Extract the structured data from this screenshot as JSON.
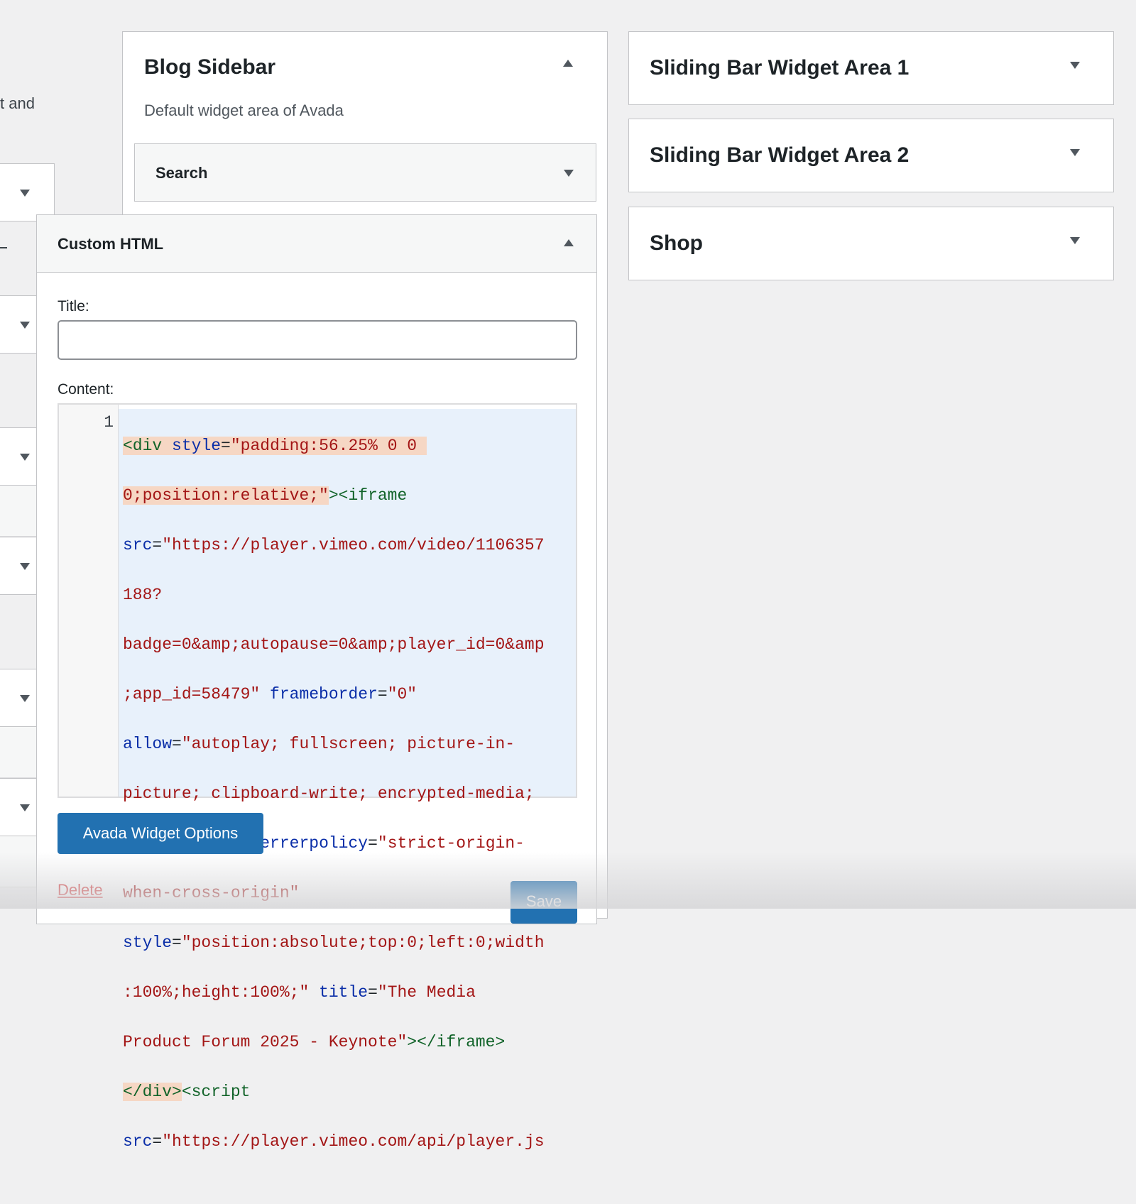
{
  "left_column": {
    "partial_text": "t and"
  },
  "blog_sidebar": {
    "title": "Blog Sidebar",
    "description": "Default widget area of Avada",
    "search_widget": "Search",
    "custom_html": {
      "title": "Custom HTML",
      "title_label": "Title:",
      "title_value": "",
      "content_label": "Content:",
      "line_number": "1",
      "code_lines": [
        "<div style=\"padding:56.25% 0 0 ",
        "0;position:relative;\"><iframe",
        "src=\"https://player.vimeo.com/video/1106357",
        "188?",
        "badge=0&amp;autopause=0&amp;player_id=0&amp",
        ";app_id=58479\" frameborder=\"0\"",
        "allow=\"autoplay; fullscreen; picture-in-",
        "picture; clipboard-write; encrypted-media;",
        "web-share\" referrerpolicy=\"strict-origin-",
        "when-cross-origin\"",
        "style=\"position:absolute;top:0;left:0;width",
        ":100%;height:100%;\" title=\"The Media",
        "Product Forum 2025 - Keynote\"></iframe>",
        "</div><script",
        "src=\"https://player.vimeo.com/api/player.js"
      ],
      "options_button": "Avada Widget Options",
      "delete_link": "Delete",
      "save_button": "Save"
    }
  },
  "right_areas": [
    {
      "title": "Sliding Bar Widget Area 1"
    },
    {
      "title": "Sliding Bar Widget Area 2"
    },
    {
      "title": "Shop"
    }
  ],
  "colors": {
    "primary": "#2271b1",
    "delete": "#d63638",
    "background": "#f0f0f1",
    "code_highlight": "#e8f1fb"
  },
  "icons": [
    "chevron-down-icon",
    "chevron-up-icon"
  ]
}
